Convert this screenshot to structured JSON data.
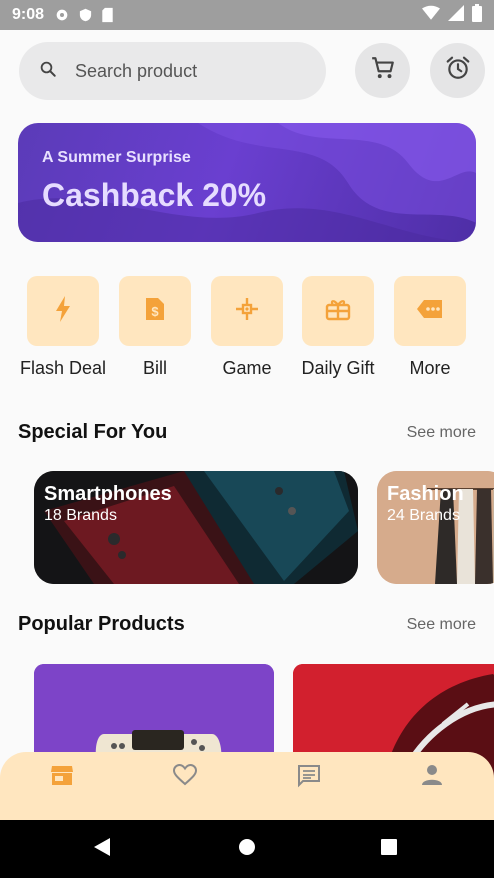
{
  "status_bar": {
    "time": "9:08"
  },
  "search": {
    "placeholder": "Search product"
  },
  "banner": {
    "subtitle": "A Summer Surprise",
    "title": "Cashback 20%"
  },
  "categories": [
    {
      "label": "Flash Deal",
      "icon": "flash-icon"
    },
    {
      "label": "Bill",
      "icon": "bill-icon"
    },
    {
      "label": "Game",
      "icon": "game-icon"
    },
    {
      "label": "Daily Gift",
      "icon": "gift-icon"
    },
    {
      "label": "More",
      "icon": "more-icon"
    }
  ],
  "special": {
    "title": "Special For You",
    "see_more": "See more",
    "cards": [
      {
        "title": "Smartphones",
        "subtitle": "18 Brands"
      },
      {
        "title": "Fashion",
        "subtitle": "24 Brands"
      }
    ]
  },
  "popular": {
    "title": "Popular Products",
    "see_more": "See more"
  },
  "nav": {
    "items": [
      "shop-icon",
      "heart-icon",
      "chat-icon",
      "user-icon"
    ]
  },
  "colors": {
    "accent": "#f4a23a",
    "category_bg": "#ffe6bf",
    "banner": "#5b3bb8"
  }
}
